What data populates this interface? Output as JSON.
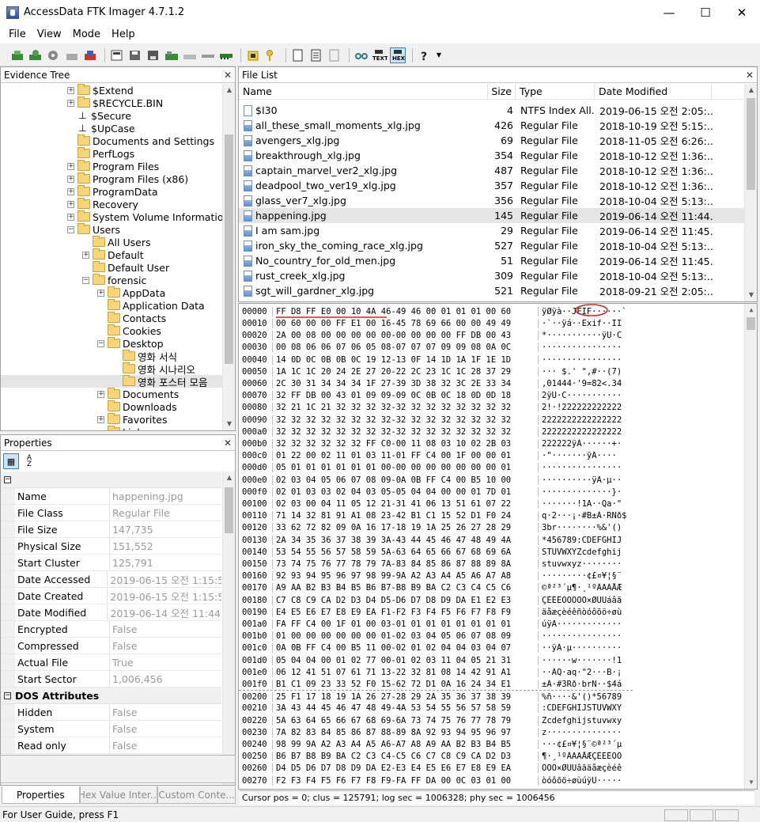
{
  "window": {
    "title": "AccessData FTK Imager 4.7.1.2"
  },
  "menu": [
    "File",
    "View",
    "Mode",
    "Help"
  ],
  "evidence_tree": {
    "title": "Evidence Tree",
    "items": [
      {
        "label": "$Extend",
        "depth": 0,
        "exp": "+",
        "kind": "folder"
      },
      {
        "label": "$RECYCLE.BIN",
        "depth": 0,
        "exp": "+",
        "kind": "folder"
      },
      {
        "label": "$Secure",
        "depth": 0,
        "exp": "",
        "kind": "sys"
      },
      {
        "label": "$UpCase",
        "depth": 0,
        "exp": "",
        "kind": "sys"
      },
      {
        "label": "Documents and Settings",
        "depth": 0,
        "exp": "",
        "kind": "folder"
      },
      {
        "label": "PerfLogs",
        "depth": 0,
        "exp": "",
        "kind": "folder"
      },
      {
        "label": "Program Files",
        "depth": 0,
        "exp": "+",
        "kind": "folder"
      },
      {
        "label": "Program Files (x86)",
        "depth": 0,
        "exp": "+",
        "kind": "folder"
      },
      {
        "label": "ProgramData",
        "depth": 0,
        "exp": "+",
        "kind": "folder"
      },
      {
        "label": "Recovery",
        "depth": 0,
        "exp": "+",
        "kind": "folder"
      },
      {
        "label": "System Volume Information",
        "depth": 0,
        "exp": "+",
        "kind": "folder"
      },
      {
        "label": "Users",
        "depth": 0,
        "exp": "-",
        "kind": "folder"
      },
      {
        "label": "All Users",
        "depth": 1,
        "exp": "",
        "kind": "folder"
      },
      {
        "label": "Default",
        "depth": 1,
        "exp": "+",
        "kind": "folder"
      },
      {
        "label": "Default User",
        "depth": 1,
        "exp": "",
        "kind": "folder"
      },
      {
        "label": "forensic",
        "depth": 1,
        "exp": "-",
        "kind": "folder"
      },
      {
        "label": "AppData",
        "depth": 2,
        "exp": "+",
        "kind": "folder"
      },
      {
        "label": "Application Data",
        "depth": 2,
        "exp": "",
        "kind": "folder"
      },
      {
        "label": "Contacts",
        "depth": 2,
        "exp": "",
        "kind": "folder"
      },
      {
        "label": "Cookies",
        "depth": 2,
        "exp": "",
        "kind": "folder"
      },
      {
        "label": "Desktop",
        "depth": 2,
        "exp": "-",
        "kind": "folder"
      },
      {
        "label": "영화 서식",
        "depth": 3,
        "exp": "",
        "kind": "folder"
      },
      {
        "label": "영화 시나리오",
        "depth": 3,
        "exp": "",
        "kind": "folder"
      },
      {
        "label": "영화 포스터 모음",
        "depth": 3,
        "exp": "",
        "kind": "folder",
        "selected": true
      },
      {
        "label": "Documents",
        "depth": 2,
        "exp": "+",
        "kind": "folder"
      },
      {
        "label": "Downloads",
        "depth": 2,
        "exp": "",
        "kind": "folder"
      },
      {
        "label": "Favorites",
        "depth": 2,
        "exp": "+",
        "kind": "folder"
      },
      {
        "label": "Links",
        "depth": 2,
        "exp": "",
        "kind": "folder"
      }
    ]
  },
  "file_list": {
    "title": "File List",
    "columns": [
      "Name",
      "Size",
      "Type",
      "Date Modified"
    ],
    "rows": [
      {
        "name": "$I30",
        "size": "4",
        "type": "NTFS Index All...",
        "date": "2019-06-15 오전 2:05:...",
        "icon": "doc"
      },
      {
        "name": "all_these_small_moments_xlg.jpg",
        "size": "426",
        "type": "Regular File",
        "date": "2018-10-19 오전 5:15:...",
        "icon": "jpg"
      },
      {
        "name": "avengers_xlg.jpg",
        "size": "69",
        "type": "Regular File",
        "date": "2018-11-05 오전 6:26:...",
        "icon": "jpg"
      },
      {
        "name": "breakthrough_xlg.jpg",
        "size": "354",
        "type": "Regular File",
        "date": "2018-10-12 오전 1:36:...",
        "icon": "jpg"
      },
      {
        "name": "captain_marvel_ver2_xlg.jpg",
        "size": "487",
        "type": "Regular File",
        "date": "2018-10-12 오전 1:36:...",
        "icon": "jpg"
      },
      {
        "name": "deadpool_two_ver19_xlg.jpg",
        "size": "357",
        "type": "Regular File",
        "date": "2018-10-12 오전 1:36:...",
        "icon": "jpg"
      },
      {
        "name": "glass_ver7_xlg.jpg",
        "size": "356",
        "type": "Regular File",
        "date": "2018-10-04 오전 5:13:...",
        "icon": "jpg"
      },
      {
        "name": "happening.jpg",
        "size": "145",
        "type": "Regular File",
        "date": "2019-06-14 오전 11:44...",
        "icon": "jpg",
        "selected": true
      },
      {
        "name": "I am sam.jpg",
        "size": "29",
        "type": "Regular File",
        "date": "2019-06-14 오전 11:45...",
        "icon": "jpg"
      },
      {
        "name": "iron_sky_the_coming_race_xlg.jpg",
        "size": "527",
        "type": "Regular File",
        "date": "2018-10-04 오전 5:13:...",
        "icon": "jpg"
      },
      {
        "name": "No_country_for_old_men.jpg",
        "size": "51",
        "type": "Regular File",
        "date": "2019-06-14 오전 11:45...",
        "icon": "jpg"
      },
      {
        "name": "rust_creek_xlg.jpg",
        "size": "309",
        "type": "Regular File",
        "date": "2018-10-04 오전 5:13:...",
        "icon": "jpg"
      },
      {
        "name": "sgt_will_gardner_xlg.jpg",
        "size": "521",
        "type": "Regular File",
        "date": "2018-09-21 오전 2:05:...",
        "icon": "jpg"
      }
    ]
  },
  "hex_view": {
    "rows": [
      {
        "off": "00000",
        "bytes": "FF D8 FF E0 00 10 4A 46-49 46 00 01 01 01 00 60",
        "ascii": "ÿØÿà··JFIF······`"
      },
      {
        "off": "00010",
        "bytes": "00 60 00 00 FF E1 00 16-45 78 69 66 00 00 49 49",
        "ascii": "·`··ÿá··Exif··II"
      },
      {
        "off": "00020",
        "bytes": "2A 00 08 00 00 00 00 00-00 00 00 00 FF DB 00 43",
        "ascii": "*···········ÿÛ·C"
      },
      {
        "off": "00030",
        "bytes": "00 08 06 06 07 06 05 08-07 07 07 09 09 08 0A 0C",
        "ascii": "················"
      },
      {
        "off": "00040",
        "bytes": "14 0D 0C 0B 0B 0C 19 12-13 0F 14 1D 1A 1F 1E 1D",
        "ascii": "················"
      },
      {
        "off": "00050",
        "bytes": "1A 1C 1C 20 24 2E 27 20-22 2C 23 1C 1C 28 37 29",
        "ascii": "··· $.' \",#··(7)"
      },
      {
        "off": "00060",
        "bytes": "2C 30 31 34 34 34 1F 27-39 3D 38 32 3C 2E 33 34",
        "ascii": ",01444·'9=82<.34"
      },
      {
        "off": "00070",
        "bytes": "32 FF DB 00 43 01 09 09-09 0C 0B 0C 18 0D 0D 18",
        "ascii": "2ÿÛ·C···········"
      },
      {
        "off": "00080",
        "bytes": "32 21 1C 21 32 32 32 32-32 32 32 32 32 32 32 32",
        "ascii": "2!·!222222222222"
      },
      {
        "off": "00090",
        "bytes": "32 32 32 32 32 32 32 32-32 32 32 32 32 32 32 32",
        "ascii": "2222222222222222"
      },
      {
        "off": "000a0",
        "bytes": "32 32 32 32 32 32 32 32-32 32 32 32 32 32 32 32",
        "ascii": "2222222222222222"
      },
      {
        "off": "000b0",
        "bytes": "32 32 32 32 32 32 FF C0-00 11 08 03 10 02 2B 03",
        "ascii": "222222ÿÀ······+·"
      },
      {
        "off": "000c0",
        "bytes": "01 22 00 02 11 01 03 11-01 FF C4 00 1F 00 00 01",
        "ascii": "·\"·······ÿÄ····"
      },
      {
        "off": "000d0",
        "bytes": "05 01 01 01 01 01 01 00-00 00 00 00 00 00 00 01",
        "ascii": "················"
      },
      {
        "off": "000e0",
        "bytes": "02 03 04 05 06 07 08 09-0A 0B FF C4 00 B5 10 00",
        "ascii": "··········ÿÄ·µ··"
      },
      {
        "off": "000f0",
        "bytes": "02 01 03 03 02 04 03 05-05 04 04 00 00 01 7D 01",
        "ascii": "··············}·"
      },
      {
        "off": "00100",
        "bytes": "02 03 00 04 11 05 12 21-31 41 06 13 51 61 07 22",
        "ascii": "·······!1A··Qa·\""
      },
      {
        "off": "00110",
        "bytes": "71 14 32 81 91 A1 08 23-42 B1 C1 15 52 D1 F0 24",
        "ascii": "q·2···¡·#B±Á·RÑð$"
      },
      {
        "off": "00120",
        "bytes": "33 62 72 82 09 0A 16 17-18 19 1A 25 26 27 28 29",
        "ascii": "3br········%&'()"
      },
      {
        "off": "00130",
        "bytes": "2A 34 35 36 37 38 39 3A-43 44 45 46 47 48 49 4A",
        "ascii": "*456789:CDEFGHIJ"
      },
      {
        "off": "00140",
        "bytes": "53 54 55 56 57 58 59 5A-63 64 65 66 67 68 69 6A",
        "ascii": "STUVWXYZcdefghij"
      },
      {
        "off": "00150",
        "bytes": "73 74 75 76 77 78 79 7A-83 84 85 86 87 88 89 8A",
        "ascii": "stuvwxyz········"
      },
      {
        "off": "00160",
        "bytes": "92 93 94 95 96 97 98 99-9A A2 A3 A4 A5 A6 A7 A8",
        "ascii": "·········¢£¤¥¦§¨"
      },
      {
        "off": "00170",
        "bytes": "A9 AA B2 B3 B4 B5 B6 B7-B8 B9 BA C2 C3 C4 C5 C6",
        "ascii": "©ª²³´µ¶·¸¹ºÂÃÄÅÆ"
      },
      {
        "off": "00180",
        "bytes": "C7 C8 C9 CA D2 D3 D4 D5-D6 D7 D8 D9 DA E1 E2 E3",
        "ascii": "ÇÈÉÊÒÓÔÕÖ×ØÙÚáâã"
      },
      {
        "off": "00190",
        "bytes": "E4 E5 E6 E7 E8 E9 EA F1-F2 F3 F4 F5 F6 F7 F8 F9",
        "ascii": "äåæçèéêñòóôõö÷øù"
      },
      {
        "off": "001a0",
        "bytes": "FA FF C4 00 1F 01 00 03-01 01 01 01 01 01 01 01",
        "ascii": "úÿÄ·············"
      },
      {
        "off": "001b0",
        "bytes": "01 00 00 00 00 00 00 01-02 03 04 05 06 07 08 09",
        "ascii": "················"
      },
      {
        "off": "001c0",
        "bytes": "0A 0B FF C4 00 B5 11 00-02 01 02 04 04 03 04 07",
        "ascii": "··ÿÄ·µ··········"
      },
      {
        "off": "001d0",
        "bytes": "05 04 04 00 01 02 77 00-01 02 03 11 04 05 21 31",
        "ascii": "······w·······!1"
      },
      {
        "off": "001e0",
        "bytes": "06 12 41 51 07 61 71 13-22 32 81 08 14 42 91 A1",
        "ascii": "··AQ·aq·\"2···B·¡"
      },
      {
        "off": "001f0",
        "bytes": "B1 C1 09 23 33 52 F0 15-62 72 D1 0A 16 24 34 E1",
        "ascii": "±Á·#3Rð·brÑ··$4á"
      },
      {
        "off": "00200",
        "bytes": "25 F1 17 18 19 1A 26 27-28 29 2A 35 36 37 38 39",
        "ascii": "%ñ····&'()*56789"
      },
      {
        "off": "00210",
        "bytes": "3A 43 44 45 46 47 48 49-4A 53 54 55 56 57 58 59",
        "ascii": ":CDEFGHIJSTUVWXY"
      },
      {
        "off": "00220",
        "bytes": "5A 63 64 65 66 67 68 69-6A 73 74 75 76 77 78 79",
        "ascii": "Zcdefghijstuvwxy"
      },
      {
        "off": "00230",
        "bytes": "7A 82 83 84 85 86 87 88-89 8A 92 93 94 95 96 97",
        "ascii": "z···············"
      },
      {
        "off": "00240",
        "bytes": "98 99 9A A2 A3 A4 A5 A6-A7 A8 A9 AA B2 B3 B4 B5",
        "ascii": "···¢£¤¥¦§¨©ª²³´µ"
      },
      {
        "off": "00250",
        "bytes": "B6 B7 B8 B9 BA C2 C3 C4-C5 C6 C7 C8 C9 CA D2 D3",
        "ascii": "¶·¸¹ºÂÃÄÅÆÇÈÉÊÒÓ"
      },
      {
        "off": "00260",
        "bytes": "D4 D5 D6 D7 D8 D9 DA E2-E3 E4 E5 E6 E7 E8 E9 EA",
        "ascii": "ÔÕÖ×ØÙÚâãäåæçèéê"
      },
      {
        "off": "00270",
        "bytes": "F2 F3 F4 F5 F6 F7 F8 F9-FA FF DA 00 0C 03 01 00",
        "ascii": "òóôõö÷øùúÿÚ·····"
      }
    ],
    "status": "Cursor pos = 0; clus = 125791; log sec = 1006328; phy sec = 1006456"
  },
  "properties": {
    "title": "Properties",
    "rows": [
      {
        "name": "Name",
        "value": "happening.jpg"
      },
      {
        "name": "File Class",
        "value": "Regular File"
      },
      {
        "name": "File Size",
        "value": "147,735"
      },
      {
        "name": "Physical Size",
        "value": "151,552"
      },
      {
        "name": "Start Cluster",
        "value": "125,791"
      },
      {
        "name": "Date Accessed",
        "value": "2019-06-15 오전 1:15:5"
      },
      {
        "name": "Date Created",
        "value": "2019-06-15 오전 1:15:5"
      },
      {
        "name": "Date Modified",
        "value": "2019-06-14 오전 11:44:"
      },
      {
        "name": "Encrypted",
        "value": "False"
      },
      {
        "name": "Compressed",
        "value": "False"
      },
      {
        "name": "Actual File",
        "value": "True"
      },
      {
        "name": "Start Sector",
        "value": "1,006,456"
      }
    ],
    "dos_category": "DOS Attributes",
    "dos_rows": [
      {
        "name": "Hidden",
        "value": "False"
      },
      {
        "name": "System",
        "value": "False"
      },
      {
        "name": "Read only",
        "value": "False"
      }
    ]
  },
  "bottom_tabs": [
    "Properties",
    "Hex Value Inter...",
    "Custom Conte..."
  ],
  "statusbar": {
    "text": "For User Guide, press F1"
  },
  "colors": {
    "annotation": "#d9231d",
    "selection": "#e5e5e5",
    "tree_selected": "#e5e5e5"
  }
}
